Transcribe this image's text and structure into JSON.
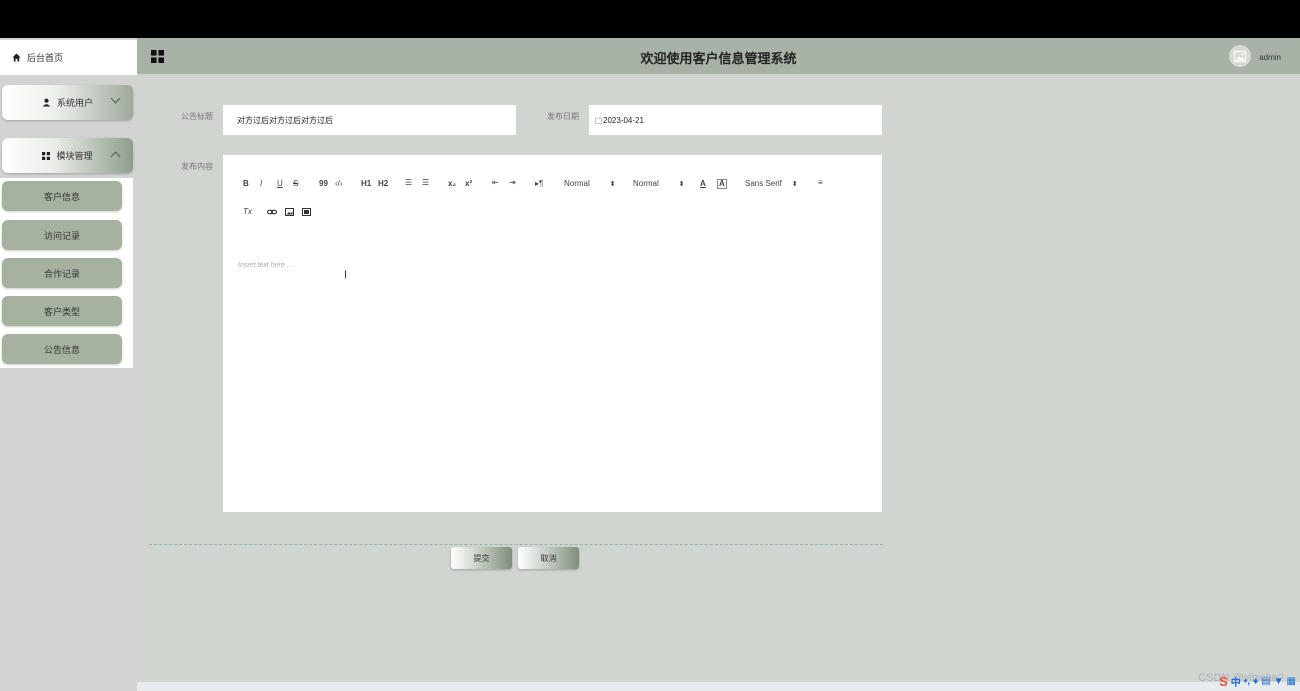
{
  "sidebar": {
    "home_label": "后台首页",
    "users_label": "系统用户",
    "modules_label": "模块管理",
    "submenu": [
      "客户信息",
      "访问记录",
      "合作记录",
      "客户类型",
      "公告信息"
    ]
  },
  "header": {
    "title": "欢迎使用客户信息管理系统",
    "user": "admin"
  },
  "form": {
    "title_label": "公告标题",
    "title_value": "对方过后对方过后对方过后",
    "date_label": "发布日期",
    "date_value": "2023-04-21",
    "content_label": "发布内容",
    "placeholder": "Insert text here ...",
    "toolbar": {
      "bold": "B",
      "italic": "I",
      "underline": "U",
      "strike": "S",
      "quote": "99",
      "code": "‹/›",
      "h1": "H1",
      "h2": "H2",
      "ol": "☰",
      "ul": "☰",
      "sub": "x₂",
      "sup": "x²",
      "indent_out": "⇤",
      "indent_in": "⇥",
      "direction": "▸¶",
      "size": "Normal",
      "header": "Normal",
      "color": "A",
      "background": "A",
      "font": "Sans Serif",
      "align": "≡",
      "clean": "Tx",
      "link": "🔗",
      "image": "▣",
      "video": "▤"
    },
    "submit_label": "提交",
    "cancel_label": "取消"
  },
  "watermark": "CSDN @yibiche?",
  "colors": {
    "header_bg": "#a9b2a6",
    "main_bg": "#d0d5cf",
    "submenu_item_bg": "#a5b2a0",
    "sidebar_bg": "#d3d3d3"
  }
}
